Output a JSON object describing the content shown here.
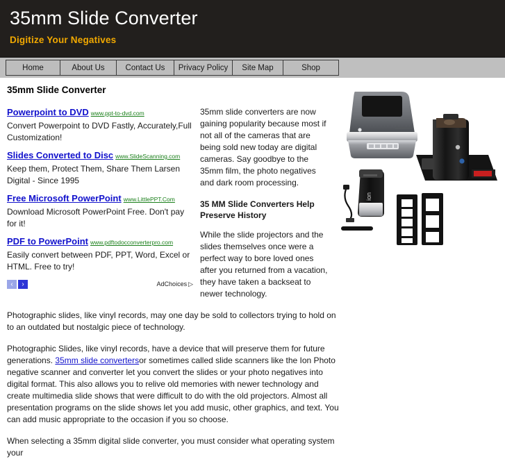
{
  "header": {
    "title": "35mm Slide Converter",
    "tagline": "Digitize Your Negatives"
  },
  "nav": {
    "items": [
      {
        "label": "Home"
      },
      {
        "label": "About Us"
      },
      {
        "label": "Contact Us"
      },
      {
        "label": "Privacy Policy"
      },
      {
        "label": "Site Map"
      },
      {
        "label": "Shop"
      }
    ]
  },
  "main": {
    "page_title": "35mm Slide Converter",
    "ads": {
      "items": [
        {
          "title": "Powerpoint to DVD",
          "url": "www.ppt-to-dvd.com",
          "description": "Convert Powerpoint to DVD Fastly, Accurately,Full Customization!"
        },
        {
          "title": "Slides Converted to Disc",
          "url": "www.SlideScanning.com",
          "description": "Keep them, Protect Them, Share Them Larsen Digital - Since 1995"
        },
        {
          "title": "Free Microsoft PowerPoint",
          "url": "www.LittlePPT.Com",
          "description": "Download Microsoft PowerPoint Free. Don't pay for it!"
        },
        {
          "title": "PDF to PowerPoint",
          "url": "www.pdftodocconverterpro.com",
          "description": "Easily convert between PDF, PPT, Word, Excel or HTML. Free to try!"
        }
      ],
      "prev_arrow": "‹",
      "next_arrow": "›",
      "adchoices_label": "AdChoices",
      "adchoices_triangle": "▷"
    },
    "mid_column": {
      "intro_paragraph": "35mm slide converters are now gaining popularity because most if not all of the cameras that are being sold new today are digital cameras. Say goodbye to the 35mm film, the photo negatives and dark room processing.",
      "subheading": "35 MM Slide Converters Help Preserve History",
      "paragraph_2": "While the slide projectors and the slides themselves once were a perfect way to bore loved ones after you returned from a vacation, they have taken a backseat to newer technology."
    },
    "flow": {
      "paragraph_wrap": "Photographic slides, like vinyl records, may one day be sold to collectors trying to hold on to an outdated but nostalgic piece of technology.",
      "paragraph_3_pre": "Photographic Slides, like vinyl records, have a device that will preserve them for future generations. ",
      "paragraph_3_link": "35mm slide converters",
      "paragraph_3_post": "or sometimes called slide scanners like the Ion Photo negative scanner and converter let you convert the slides or your photo negatives into digital format. This also allows you to relive old memories with newer technology and create multimedia slide shows that were difficult to do with the old projectors. Almost all presentation programs on the slide shows let you add music, other graphics, and text. You can add music appropriate to the occasion if you so choose.",
      "paragraph_4": "When selecting a 35mm digital slide converter, you must consider what operating system your"
    },
    "product_image_alt": "slide scanner product collage"
  },
  "colors": {
    "header_bg": "#221f1d",
    "tagline": "#f2a900",
    "nav_bg": "#bfbfbf",
    "ad_title_link": "#1111cc",
    "ad_url_link": "#1a7f1a"
  }
}
